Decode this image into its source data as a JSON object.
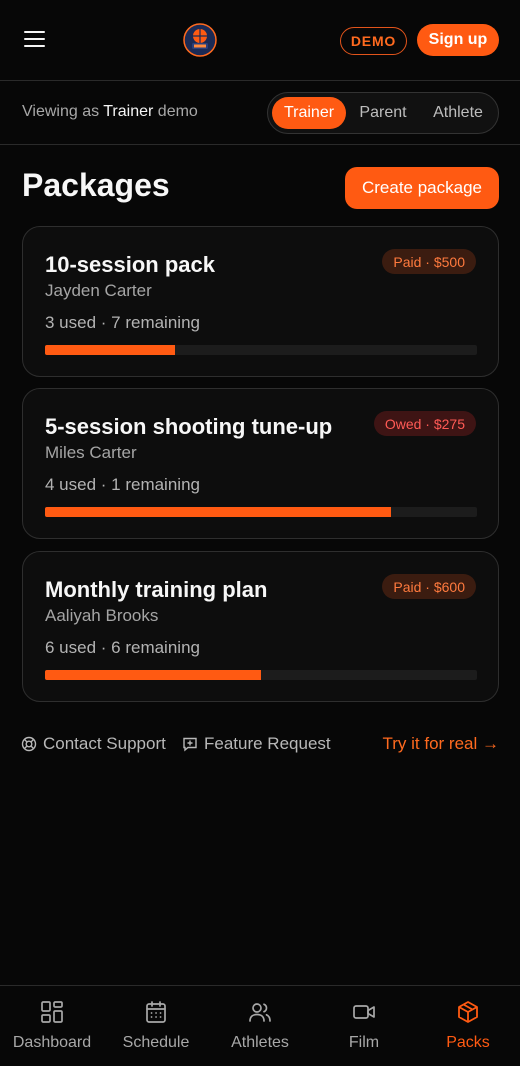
{
  "header": {
    "demo_label": "DEMO",
    "signup_label": "Sign up"
  },
  "viewbar": {
    "prefix": "Viewing as",
    "role": "Trainer",
    "suffix": "demo",
    "roles": [
      "Trainer",
      "Parent",
      "Athlete"
    ],
    "active_role": "Trainer"
  },
  "main": {
    "title": "Packages",
    "create_label": "Create package",
    "packages": [
      {
        "title": "10-session pack",
        "client": "Jayden Carter",
        "usage": "3 used · 7 remaining",
        "badge": "Paid · $500",
        "status": "paid",
        "progress": 0.3
      },
      {
        "title": "5-session shooting tune-up",
        "client": "Miles Carter",
        "usage": "4 used · 1 remaining",
        "badge": "Owed · $275",
        "status": "owed",
        "progress": 0.8
      },
      {
        "title": "Monthly training plan",
        "client": "Aaliyah Brooks",
        "usage": "6 used · 6 remaining",
        "badge": "Paid · $600",
        "status": "paid",
        "progress": 0.5
      }
    ]
  },
  "footer": {
    "support_label": "Contact Support",
    "feature_label": "Feature Request",
    "try_label": "Try it for real →"
  },
  "nav": {
    "items": [
      {
        "label": "Dashboard",
        "icon": "dashboard-icon"
      },
      {
        "label": "Schedule",
        "icon": "calendar-icon"
      },
      {
        "label": "Athletes",
        "icon": "users-icon"
      },
      {
        "label": "Film",
        "icon": "video-icon"
      },
      {
        "label": "Packs",
        "icon": "package-icon"
      }
    ],
    "active": "Packs"
  },
  "colors": {
    "accent": "#ff5a12",
    "background": "#070707",
    "card": "#0d0d0d",
    "paid_badge": "#3b1c10",
    "owed_badge": "#3e1414"
  }
}
